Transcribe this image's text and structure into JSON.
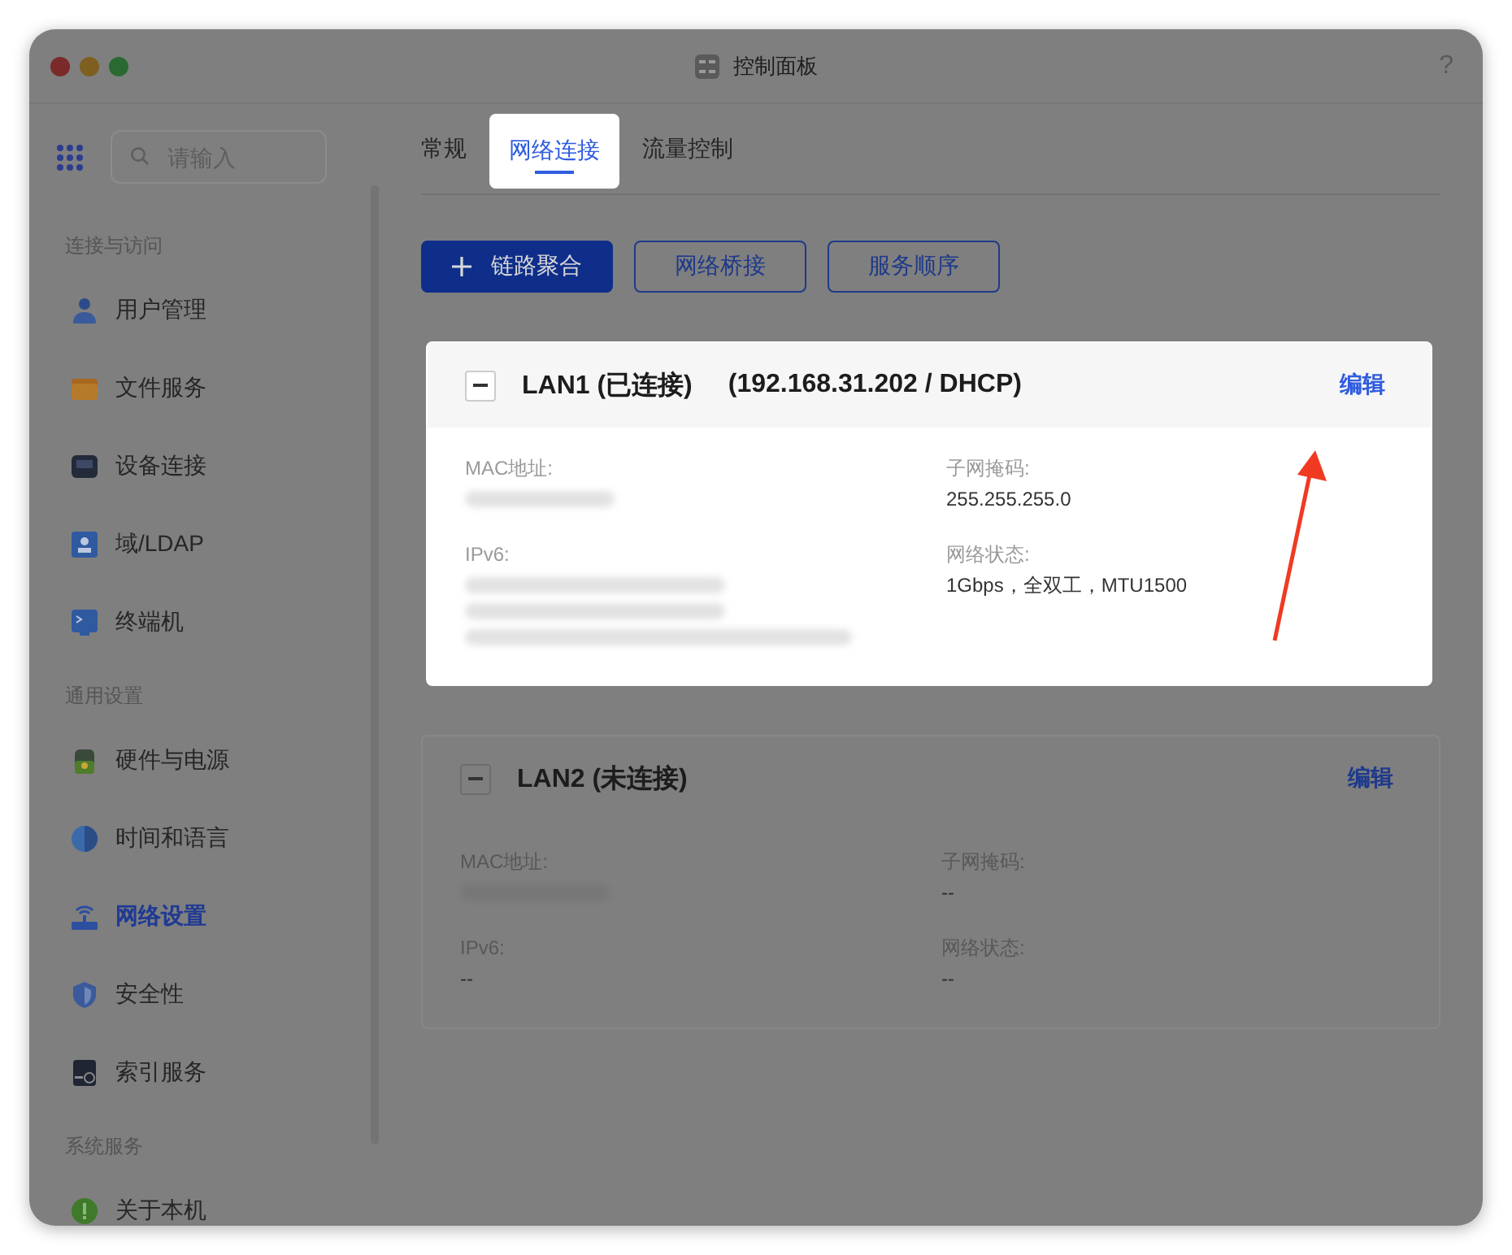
{
  "window": {
    "title": "控制面板",
    "help": "?"
  },
  "sidebar": {
    "search": {
      "placeholder": "请输入"
    },
    "sections": [
      {
        "title": "连接与访问",
        "items": [
          {
            "label": "用户管理",
            "selected": false
          },
          {
            "label": "文件服务",
            "selected": false
          },
          {
            "label": "设备连接",
            "selected": false
          },
          {
            "label": "域/LDAP",
            "selected": false
          },
          {
            "label": "终端机",
            "selected": false
          }
        ]
      },
      {
        "title": "通用设置",
        "items": [
          {
            "label": "硬件与电源",
            "selected": false
          },
          {
            "label": "时间和语言",
            "selected": false
          },
          {
            "label": "网络设置",
            "selected": true
          },
          {
            "label": "安全性",
            "selected": false
          },
          {
            "label": "索引服务",
            "selected": false
          }
        ]
      },
      {
        "title": "系统服务",
        "items": [
          {
            "label": "关于本机",
            "selected": false
          }
        ]
      }
    ]
  },
  "tabs": [
    {
      "label": "常规",
      "selected": false
    },
    {
      "label": "网络连接",
      "selected": true
    },
    {
      "label": "流量控制",
      "selected": false
    }
  ],
  "toolbar": [
    {
      "label": "链路聚合",
      "kind": "primary"
    },
    {
      "label": "网络桥接",
      "kind": "outline"
    },
    {
      "label": "服务顺序",
      "kind": "outline"
    }
  ],
  "interfaces": [
    {
      "name": "LAN1 (已连接)",
      "address": "(192.168.31.202 / DHCP)",
      "edit": "编辑",
      "expanded": true,
      "highlighted": true,
      "fields": [
        {
          "label": "MAC地址:",
          "redacted": true
        },
        {
          "label": "子网掩码:",
          "value": "255.255.255.0"
        },
        {
          "label": "IPv6:",
          "redacted": true
        },
        {
          "label": "网络状态:",
          "value": "1Gbps，全双工，MTU1500"
        }
      ]
    },
    {
      "name": "LAN2 (未连接)",
      "edit": "编辑",
      "expanded": true,
      "highlighted": false,
      "fields": [
        {
          "label": "MAC地址:",
          "redacted": true
        },
        {
          "label": "子网掩码:",
          "value": "--"
        },
        {
          "label": "IPv6:",
          "value": "--"
        },
        {
          "label": "网络状态:",
          "value": "--"
        }
      ]
    }
  ],
  "callout_arrow": true
}
